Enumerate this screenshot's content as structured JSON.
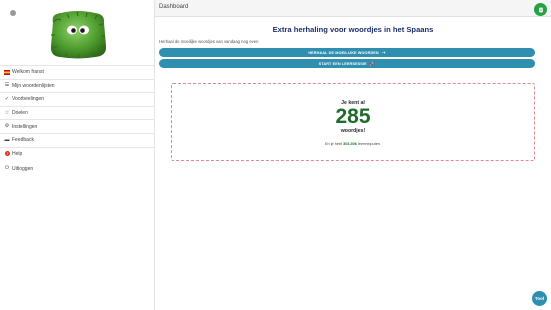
{
  "header": {
    "title": "Dashboard",
    "badge_icon": "book-icon",
    "badge_color": "#27a243"
  },
  "sidebar": {
    "items": [
      {
        "label": "Welkom franst",
        "icon": "flag-icon"
      },
      {
        "label": "Mijn woordenlijsten",
        "icon": "list-icon"
      },
      {
        "label": "Voorbeelingen",
        "icon": "check-icon"
      },
      {
        "label": "Doelen",
        "icon": "star-icon"
      },
      {
        "label": "Instellingen",
        "icon": "gear-icon"
      },
      {
        "label": "Feedback",
        "icon": "message-icon"
      },
      {
        "label": "Help",
        "icon": "help-icon"
      },
      {
        "label": "Uitloggen",
        "icon": "logout-icon"
      }
    ]
  },
  "main": {
    "title": "Extra herhaling voor woordjes in het Spaans",
    "subtitle": "Herhaal de moeilijke woordjes van vandaag nog even",
    "button_repeat": "HERHAAL DE MOEILIJKE WOORDEN",
    "button_start": "START EEN LEERSESSIE",
    "button_color": "#2e8fb0",
    "card": {
      "top_text": "Je kent al",
      "count": "285",
      "bottom_text": "woordjes!",
      "note_prefix": "En je hebt",
      "note_highlight": "303.306",
      "note_suffix": "leerminputen."
    },
    "fab_label": "Tool"
  }
}
